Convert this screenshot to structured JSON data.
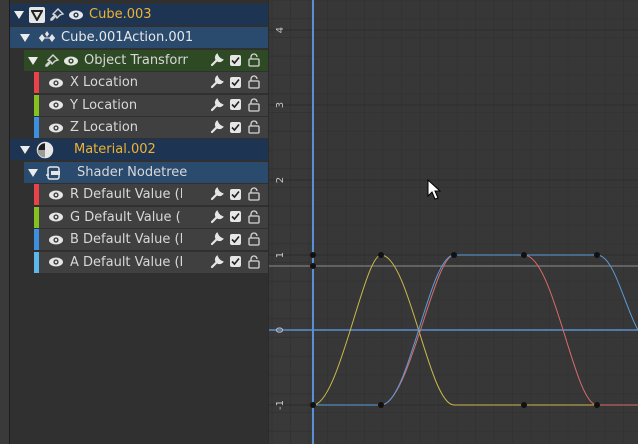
{
  "channels": {
    "object": {
      "name": "Cube.003",
      "color": "#f0b232"
    },
    "action": {
      "name": "Cube.001Action.001"
    },
    "transform_group": {
      "name": "Object Transform"
    },
    "transform_channels": [
      {
        "label": "X Location",
        "color": "#e8424a"
      },
      {
        "label": "Y Location",
        "color": "#86c21f"
      },
      {
        "label": "Z Location",
        "color": "#3d8fe0"
      }
    ],
    "material": {
      "name": "Material.002",
      "color": "#f0b232"
    },
    "nodetree": {
      "name": "Shader Nodetree"
    },
    "material_channels": [
      {
        "label": "R Default Value (Ba",
        "color": "#e8424a"
      },
      {
        "label": "G Default Value (Ba",
        "color": "#86c21f"
      },
      {
        "label": "B Default Value (Ba",
        "color": "#3d8fe0"
      },
      {
        "label": "A Default Value (Ba",
        "color": "#5cb8ea"
      }
    ]
  },
  "graph": {
    "y_labels": [
      "4",
      "3",
      "2",
      "1",
      "0",
      "-1"
    ]
  }
}
